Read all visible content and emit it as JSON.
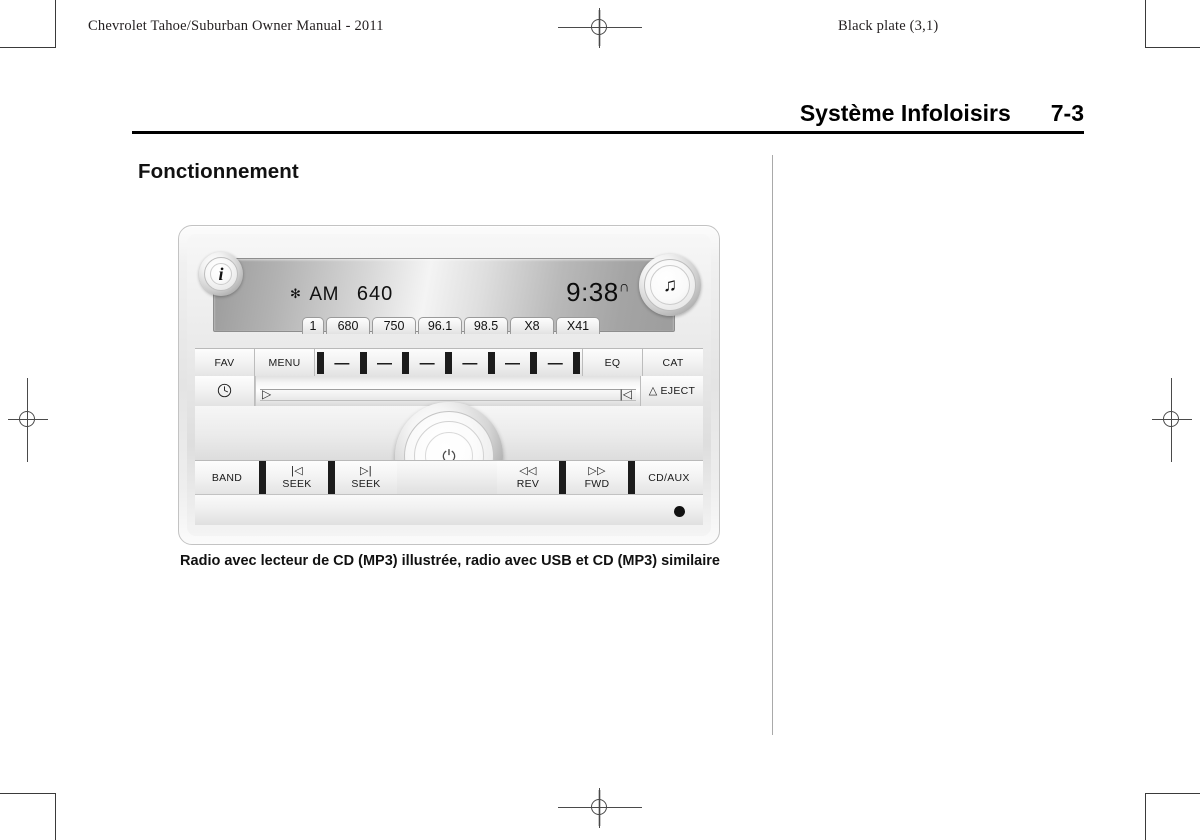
{
  "page": {
    "header_left": "Chevrolet Tahoe/Suburban Owner Manual - 2011",
    "header_right": "Black plate (3,1)",
    "chapter_title": "Système Infoloisirs",
    "page_number": "7-3",
    "section_heading": "Fonctionnement",
    "figure_caption": "Radio avec lecteur de CD (MP3) illustrée, radio avec USB et CD (MP3) similaire"
  },
  "radio": {
    "display": {
      "source_indicator": "✻",
      "band": "AM",
      "frequency": "640",
      "time": "9:38",
      "time_suffix": "∩",
      "presets": [
        "1",
        "680",
        "750",
        "96.1",
        "98.5",
        "X8",
        "X41"
      ]
    },
    "knobs": {
      "info_label": "i",
      "music_label": "♫",
      "power_label": "⏻"
    },
    "row1": {
      "fav": "FAV",
      "menu": "MENU",
      "preset_dash": "—",
      "eq": "EQ",
      "cat": "CAT"
    },
    "row2": {
      "clock": "🕐",
      "play": "▷",
      "prev": "|◁",
      "eject_symbol": "△",
      "eject_label": "EJECT"
    },
    "row3": {
      "band": "BAND",
      "seek_back_symbol": "|◁",
      "seek_back_label": "SEEK",
      "seek_fwd_symbol": "▷|",
      "seek_fwd_label": "SEEK",
      "rev_symbol": "◁◁",
      "rev_label": "REV",
      "fwd_symbol": "▷▷",
      "fwd_label": "FWD",
      "cd_aux": "CD/AUX"
    }
  }
}
